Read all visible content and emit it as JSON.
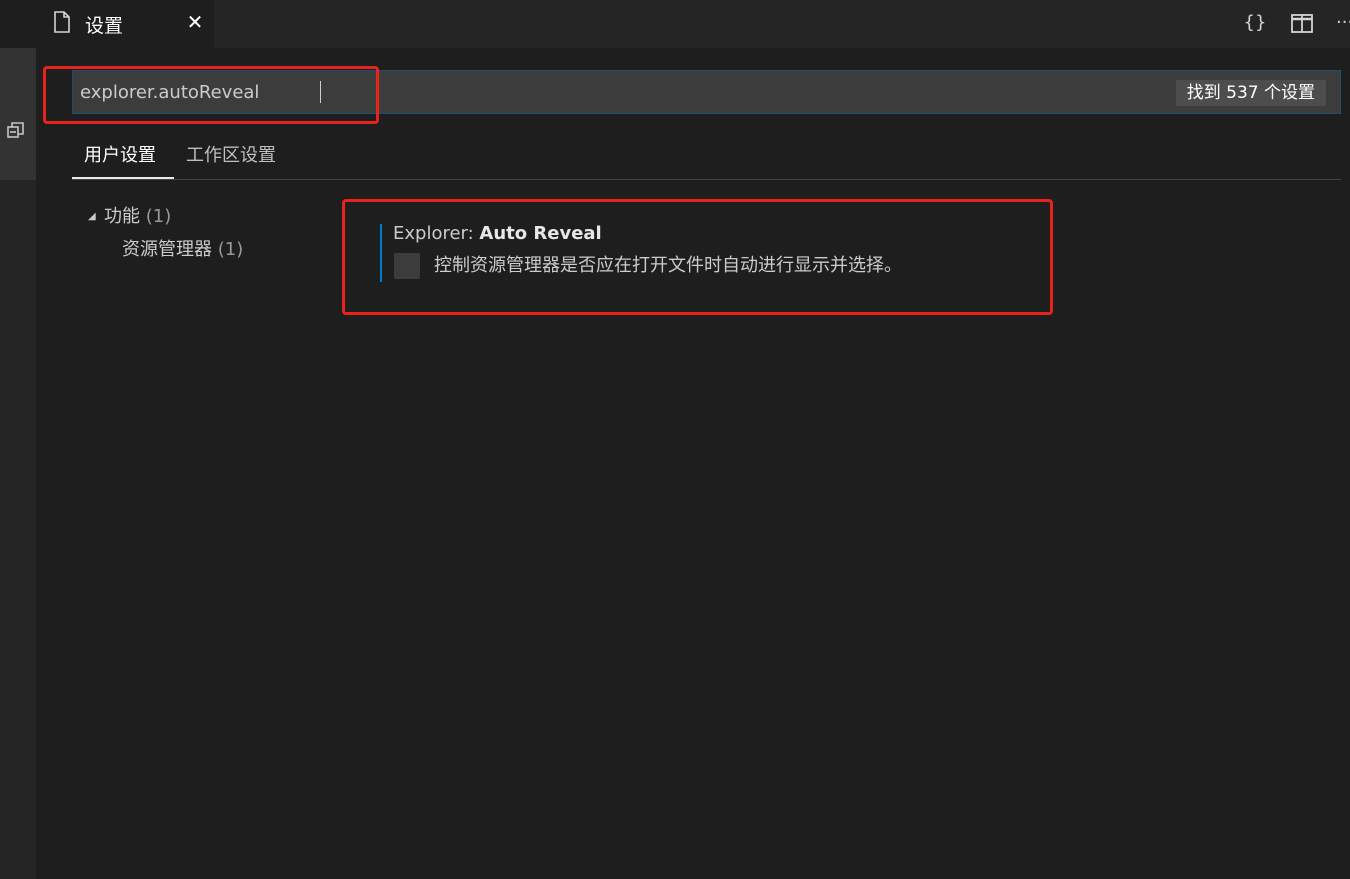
{
  "tab": {
    "label": "设置",
    "icon": "file-icon",
    "close_icon": "close-icon"
  },
  "toolbar": {
    "json_icon": "{}",
    "split_icon": "split-editor-icon",
    "more_icon": "···"
  },
  "search": {
    "value": "explorer.autoReveal",
    "result_count": "找到 537 个设置"
  },
  "scope_tabs": [
    {
      "label": "用户设置",
      "active": true
    },
    {
      "label": "工作区设置",
      "active": false
    }
  ],
  "toc": {
    "group": {
      "label": "功能",
      "count": "(1)"
    },
    "child": {
      "label": "资源管理器",
      "count": "(1)"
    }
  },
  "setting": {
    "category": "Explorer: ",
    "name": "Auto Reveal",
    "checked": false,
    "description": "控制资源管理器是否应在打开文件时自动进行显示并选择。"
  },
  "colors": {
    "background": "#1e1e1e",
    "accent": "#007acc",
    "annotation": "#e8231d"
  }
}
